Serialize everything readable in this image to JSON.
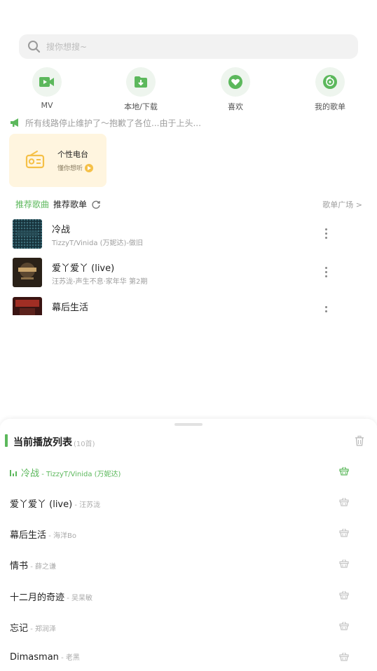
{
  "search": {
    "placeholder": "搜你想搜~"
  },
  "quick_nav": [
    {
      "label": "MV",
      "icon": "video-icon"
    },
    {
      "label": "本地/下载",
      "icon": "download-folder-icon"
    },
    {
      "label": "喜欢",
      "icon": "heart-icon"
    },
    {
      "label": "我的歌单",
      "icon": "disc-icon"
    }
  ],
  "notice": {
    "text": "所有线路停止维护了～抱歉了各位...由于上头..."
  },
  "radio_card": {
    "title": "个性电台",
    "subtitle": "懂你想听"
  },
  "tabs": {
    "recommend_songs": "推荐歌曲",
    "recommend_playlists": "推荐歌单"
  },
  "playlist_square": "歌单广场 >",
  "songs": [
    {
      "title": "冷战",
      "subtitle": "TizzyT/Vinida (万妮达)-做旧"
    },
    {
      "title": "爱丫爱丫 (live)",
      "subtitle": "汪苏泷-声生不息·家年华 第2期"
    },
    {
      "title": "幕后生活",
      "subtitle": ""
    }
  ],
  "panel": {
    "title": "当前播放列表",
    "count": "(10首)",
    "items": [
      {
        "title": "冷战",
        "artist": " - TizzyT/Vinida (万妮达)",
        "active": true
      },
      {
        "title": "爱丫爱丫 (live)",
        "artist": " - 汪苏泷"
      },
      {
        "title": "幕后生活",
        "artist": " - 海洋Bo"
      },
      {
        "title": "情书",
        "artist": " - 薛之谦"
      },
      {
        "title": "十二月的奇迹",
        "artist": " - 吴杲敏"
      },
      {
        "title": "忘记",
        "artist": " - 郑润泽"
      },
      {
        "title": "Dimasman",
        "artist": " - 老黑"
      }
    ]
  },
  "colors": {
    "accent": "#5cb85c",
    "radio_bg": "#fff5df",
    "radio_icon": "#f5c047"
  }
}
